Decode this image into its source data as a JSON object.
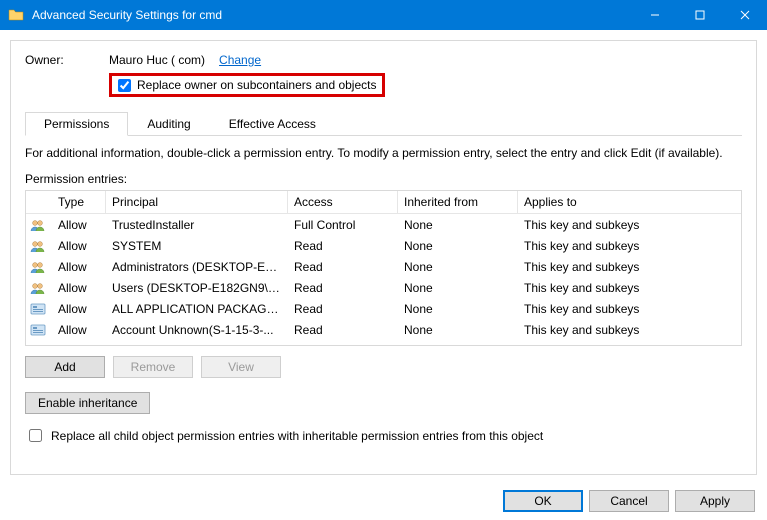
{
  "titlebar": {
    "title": "Advanced Security Settings for cmd"
  },
  "owner": {
    "label": "Owner:",
    "name": "Mauro Huc (                                      com)",
    "change": "Change",
    "replace_checkbox_label": "Replace owner on subcontainers and objects"
  },
  "tabs": {
    "permissions": "Permissions",
    "auditing": "Auditing",
    "effective": "Effective Access"
  },
  "info_text": "For additional information, double-click a permission entry. To modify a permission entry, select the entry and click Edit (if available).",
  "pe_label": "Permission entries:",
  "columns": {
    "type": "Type",
    "principal": "Principal",
    "access": "Access",
    "inherited": "Inherited from",
    "applies": "Applies to"
  },
  "rows": [
    {
      "icon": "group",
      "type": "Allow",
      "principal": "TrustedInstaller",
      "access": "Full Control",
      "inherited": "None",
      "applies": "This key and subkeys"
    },
    {
      "icon": "group",
      "type": "Allow",
      "principal": "SYSTEM",
      "access": "Read",
      "inherited": "None",
      "applies": "This key and subkeys"
    },
    {
      "icon": "group",
      "type": "Allow",
      "principal": "Administrators (DESKTOP-E18...",
      "access": "Read",
      "inherited": "None",
      "applies": "This key and subkeys"
    },
    {
      "icon": "group",
      "type": "Allow",
      "principal": "Users (DESKTOP-E182GN9\\Us...",
      "access": "Read",
      "inherited": "None",
      "applies": "This key and subkeys"
    },
    {
      "icon": "package",
      "type": "Allow",
      "principal": "ALL APPLICATION PACKAGES",
      "access": "Read",
      "inherited": "None",
      "applies": "This key and subkeys"
    },
    {
      "icon": "package",
      "type": "Allow",
      "principal": "Account Unknown(S-1-15-3-...",
      "access": "Read",
      "inherited": "None",
      "applies": "This key and subkeys"
    }
  ],
  "buttons": {
    "add": "Add",
    "remove": "Remove",
    "view": "View",
    "enable_inheritance": "Enable inheritance",
    "replace_all": "Replace all child object permission entries with inheritable permission entries from this object",
    "ok": "OK",
    "cancel": "Cancel",
    "apply": "Apply"
  }
}
